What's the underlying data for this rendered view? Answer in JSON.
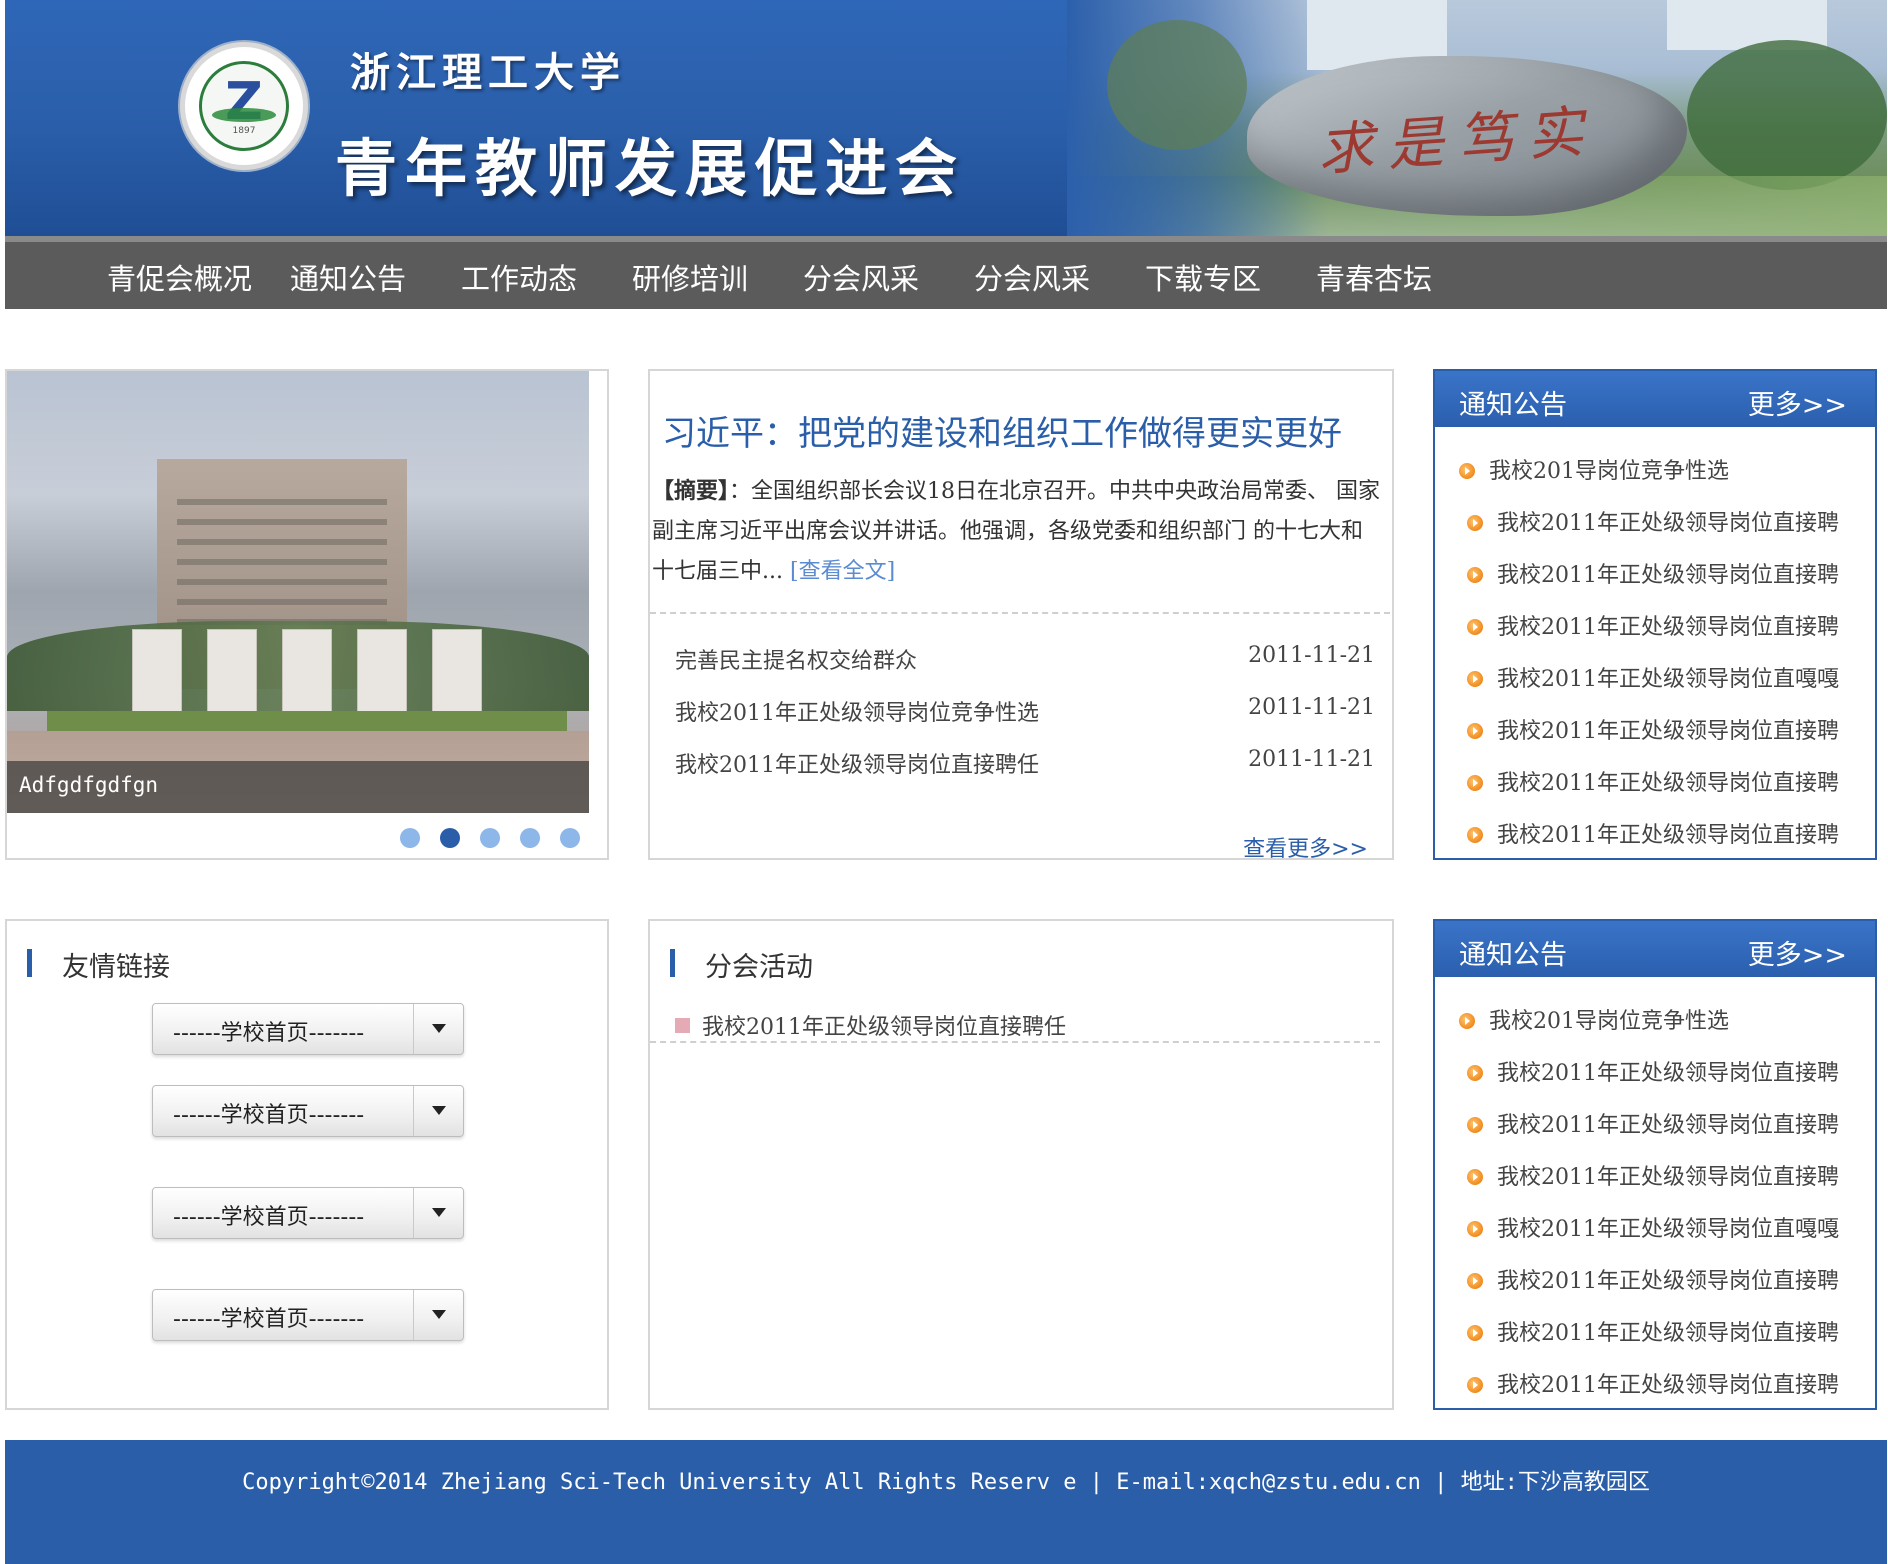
{
  "header": {
    "school_name": "浙江理工大学",
    "site_title": "青年教师发展促进会",
    "logo_year": "1897",
    "rock_inscription": "求是笃实"
  },
  "nav": {
    "items": [
      "青促会概况",
      "通知公告",
      "工作动态",
      "研修培训",
      "分会风采",
      "分会风采",
      "下载专区",
      "青春杏坛"
    ]
  },
  "slider": {
    "caption": "Adfgdfgdfgn",
    "dot_count": 5,
    "active_index": 1
  },
  "headline": {
    "title": "习近平：把党的建设和组织工作做得更实更好",
    "summary_label": "【摘要】",
    "summary_text": "：全国组织部长会议18日在北京召开。中共中央政治局常委、 国家副主席习近平出席会议并讲话。他强调，各级党委和组织部门 的十七大和十七届三中...",
    "read_full_label": "[查看全文]",
    "news": [
      {
        "title": "完善民主提名权交给群众",
        "date": "2011-11-21"
      },
      {
        "title": "我校2011年正处级领导岗位竞争性选",
        "date": "2011-11-21"
      },
      {
        "title": "我校2011年正处级领导岗位直接聘任",
        "date": "2011-11-21"
      }
    ],
    "more_label": "查看更多>>"
  },
  "notice_panel_1": {
    "title": "通知公告",
    "more_label": "更多>>",
    "items": [
      "我校201导岗位竞争性选",
      "我校2011年正处级领导岗位直接聘",
      "我校2011年正处级领导岗位直接聘",
      "我校2011年正处级领导岗位直接聘",
      "我校2011年正处级领导岗位直嘎嘎",
      "我校2011年正处级领导岗位直接聘",
      "我校2011年正处级领导岗位直接聘",
      "我校2011年正处级领导岗位直接聘"
    ]
  },
  "notice_panel_2": {
    "title": "通知公告",
    "more_label": "更多>>",
    "items": [
      "我校201导岗位竞争性选",
      "我校2011年正处级领导岗位直接聘",
      "我校2011年正处级领导岗位直接聘",
      "我校2011年正处级领导岗位直接聘",
      "我校2011年正处级领导岗位直嘎嘎",
      "我校2011年正处级领导岗位直接聘",
      "我校2011年正处级领导岗位直接聘",
      "我校2011年正处级领导岗位直接聘"
    ]
  },
  "links": {
    "title": "友情链接",
    "selects": [
      "------学校首页-------",
      "------学校首页-------",
      "------学校首页-------",
      "------学校首页-------"
    ]
  },
  "activity": {
    "title": "分会活动",
    "items": [
      "我校2011年正处级领导岗位直接聘任"
    ]
  },
  "footer": {
    "text": "Copyright©2014 Zhejiang Sci-Tech University All Rights Reserv e | E-mail:xqch@zstu.edu.cn | 地址:下沙高教园区"
  },
  "colors": {
    "brand_blue": "#2a5ea9",
    "nav_gray": "#5b5b5b",
    "bullet_orange": "#f08a1c",
    "link_blue": "#5b8bd0"
  },
  "icons": [
    "orange-arrow-bullet-icon",
    "dropdown-arrow-icon",
    "pink-square-bullet-icon"
  ]
}
